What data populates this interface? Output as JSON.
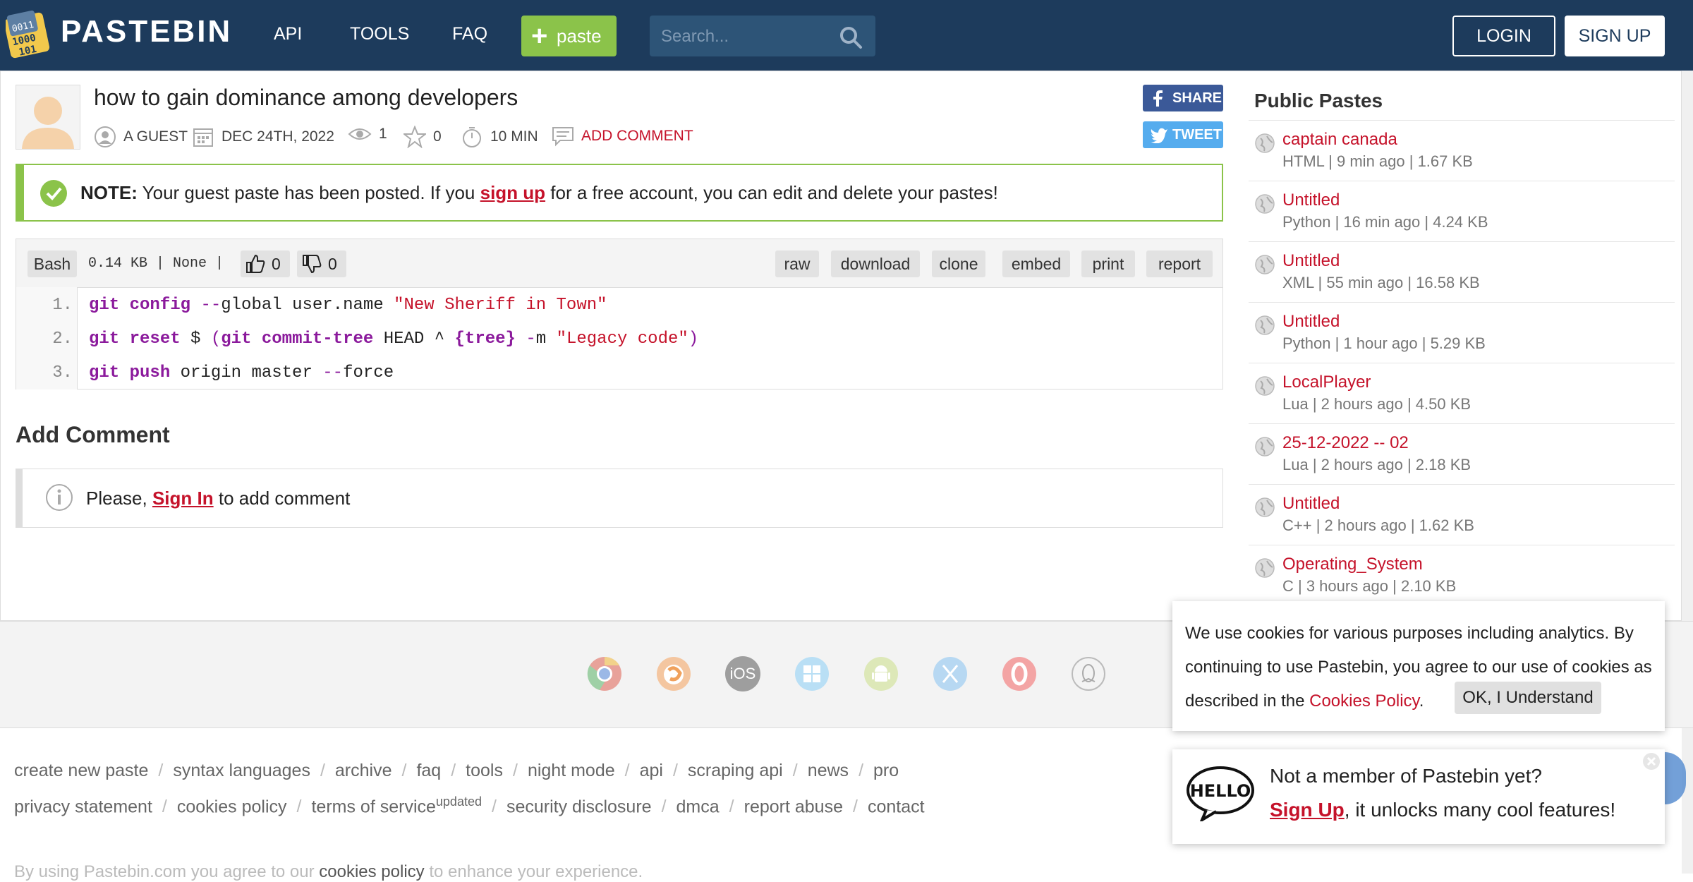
{
  "header": {
    "logo_text": "PASTEBIN",
    "nav": [
      "API",
      "TOOLS",
      "FAQ"
    ],
    "paste_button": "paste",
    "search_placeholder": "Search...",
    "login": "LOGIN",
    "signup": "SIGN UP",
    "colors": {
      "bar": "#1d3b5c",
      "paste_button": "#8bc34a"
    }
  },
  "paste": {
    "title": "how to gain dominance among developers",
    "author": "A GUEST",
    "date": "DEC 24TH, 2022",
    "views": "1",
    "stars": "0",
    "expires": "10 MIN",
    "add_comment": "ADD COMMENT",
    "share": "SHARE",
    "tweet": "TWEET"
  },
  "note": {
    "label": "NOTE:",
    "text_before": "Your guest paste has been posted. If you",
    "link": "sign up",
    "text_after": "for a free account, you can edit and delete your pastes!"
  },
  "code": {
    "language": "Bash",
    "info": "0.14 KB | None |",
    "likes": "0",
    "dislikes": "0",
    "actions": [
      "raw",
      "download",
      "clone",
      "embed",
      "print",
      "report"
    ],
    "line_numbers": [
      "1.",
      "2.",
      "3."
    ],
    "lines": [
      "git config --global user.name \"New Sheriff in Town\"",
      "git reset $ (git commit-tree HEAD ^ {tree} -m \"Legacy code\")",
      "git push origin master --force"
    ]
  },
  "comments": {
    "heading": "Add Comment",
    "please": "Please,",
    "signin": "Sign In",
    "suffix": "to add comment"
  },
  "sidebar": {
    "title": "Public Pastes",
    "items": [
      {
        "name": "captain canada",
        "info": "HTML | 9 min ago | 1.67 KB"
      },
      {
        "name": "Untitled",
        "info": "Python | 16 min ago | 4.24 KB"
      },
      {
        "name": "Untitled",
        "info": "XML | 55 min ago | 16.58 KB"
      },
      {
        "name": "Untitled",
        "info": "Python | 1 hour ago | 5.29 KB"
      },
      {
        "name": "LocalPlayer",
        "info": "Lua | 2 hours ago | 4.50 KB"
      },
      {
        "name": "25-12-2022 -- 02",
        "info": "Lua | 2 hours ago | 2.18 KB"
      },
      {
        "name": "Untitled",
        "info": "C++ | 2 hours ago | 1.62 KB"
      },
      {
        "name": "Operating_System",
        "info": "C | 3 hours ago | 2.10 KB"
      }
    ]
  },
  "footer": {
    "app_icons": [
      "chrome-icon",
      "firefox-icon",
      "ios-icon",
      "windows-icon",
      "android-icon",
      "macos-icon",
      "opera-icon",
      "linux-icon"
    ],
    "ios_label": "iOS",
    "links_row1": [
      "create new paste",
      "syntax languages",
      "archive",
      "faq",
      "tools",
      "night mode",
      "api",
      "scraping api",
      "news",
      "pro"
    ],
    "links_row2": [
      "privacy statement",
      "cookies policy",
      "terms of service",
      "security disclosure",
      "dmca",
      "report abuse",
      "contact"
    ],
    "tos_badge": "updated",
    "copy_before": "By using Pastebin.com you agree to our",
    "copy_link": "cookies policy",
    "copy_after": "to enhance your experience."
  },
  "cookie_popup": {
    "text": "We use cookies for various purposes including analytics. By continuing to use Pastebin, you agree to our use of cookies as described in the",
    "link": "Cookies Policy",
    "ok": "OK, I Understand"
  },
  "member_popup": {
    "line1": "Not a member of Pastebin yet?",
    "signup": "Sign Up",
    "line2_rest": ", it unlocks many cool features!"
  }
}
